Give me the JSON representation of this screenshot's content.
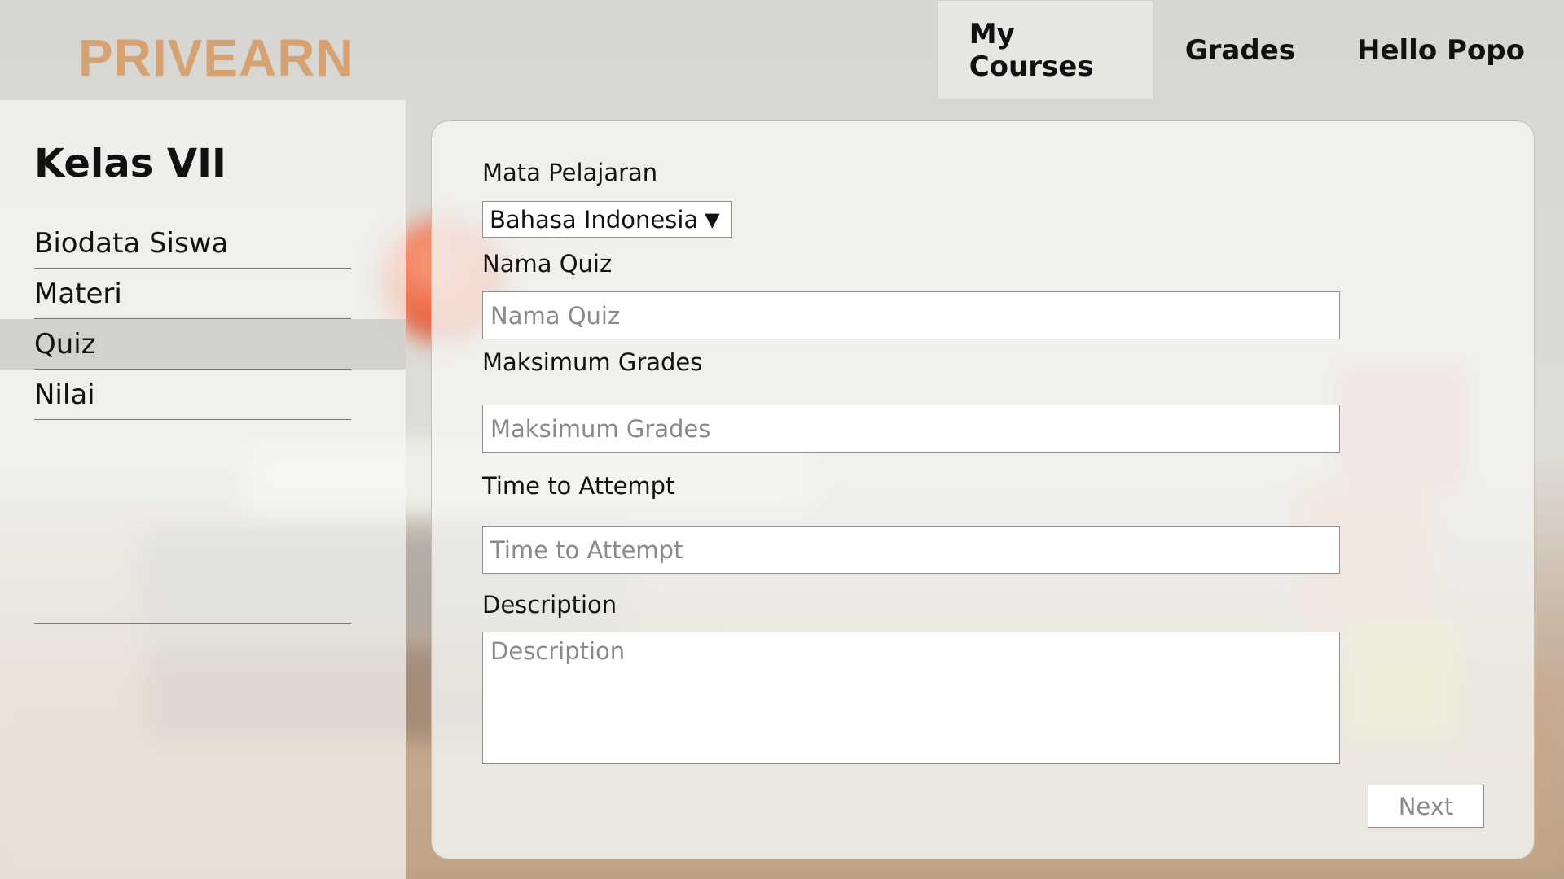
{
  "header": {
    "logo": "PRIVEARN",
    "nav": [
      {
        "label": "My Courses",
        "active": true
      },
      {
        "label": "Grades",
        "active": false
      },
      {
        "label": "Hello Popo",
        "active": false
      }
    ]
  },
  "sidebar": {
    "title": "Kelas VII",
    "items": [
      {
        "label": "Biodata Siswa",
        "active": false
      },
      {
        "label": "Materi",
        "active": false
      },
      {
        "label": "Quiz",
        "active": true
      },
      {
        "label": "Nilai",
        "active": false
      }
    ]
  },
  "form": {
    "subject": {
      "label": "Mata Pelajaran",
      "value": "Bahasa Indonesia",
      "arrow": "▼"
    },
    "quiz_name": {
      "label": "Nama Quiz",
      "placeholder": "Nama Quiz",
      "value": ""
    },
    "max_grades": {
      "label": "Maksimum Grades",
      "placeholder": "Maksimum Grades",
      "value": ""
    },
    "time_to_attempt": {
      "label": "Time to Attempt",
      "placeholder": "Time to Attempt",
      "value": ""
    },
    "description": {
      "label": "Description",
      "placeholder": "Description",
      "value": ""
    },
    "next_label": "Next"
  },
  "colors": {
    "logo": "#d7a272",
    "active_nav": "#ebebe8",
    "active_sidebar": "#cdcdcb"
  }
}
